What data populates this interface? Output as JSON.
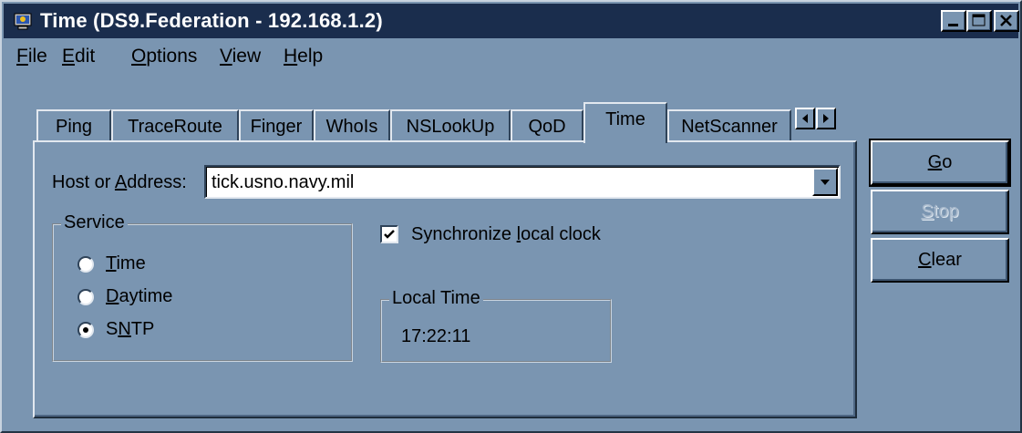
{
  "window": {
    "title": "Time (DS9.Federation - 192.168.1.2)"
  },
  "menubar": {
    "items": [
      {
        "label": "File",
        "mnemonic": "F",
        "rest": "ile"
      },
      {
        "label": "Edit",
        "mnemonic": "E",
        "rest": "dit"
      },
      {
        "label": "Options",
        "mnemonic": "O",
        "rest": "ptions"
      },
      {
        "label": "View",
        "mnemonic": "V",
        "rest": "iew"
      },
      {
        "label": "Help",
        "mnemonic": "H",
        "rest": "elp"
      }
    ]
  },
  "tabs": [
    {
      "label": "Ping"
    },
    {
      "label": "TraceRoute"
    },
    {
      "label": "Finger"
    },
    {
      "label": "WhoIs"
    },
    {
      "label": "NSLookUp"
    },
    {
      "label": "QoD"
    },
    {
      "label": "Time",
      "active": true
    },
    {
      "label": "NetScanner"
    }
  ],
  "host": {
    "label_pre": "Host or ",
    "label_mnemonic": "A",
    "label_post": "ddress:",
    "value": "tick.usno.navy.mil"
  },
  "service": {
    "legend": "Service",
    "options": [
      {
        "mnemonic": "T",
        "rest": "ime",
        "label": "Time",
        "selected": false
      },
      {
        "mnemonic": "D",
        "rest": "aytime",
        "label": "Daytime",
        "selected": false
      },
      {
        "pre": "S",
        "mnemonic": "N",
        "rest": "TP",
        "label": "SNTP",
        "selected": true
      }
    ]
  },
  "sync": {
    "label_pre": "Synchronize ",
    "label_mnemonic": "l",
    "label_post": "ocal clock",
    "checked": true
  },
  "local_time": {
    "legend": "Local Time",
    "value": "17:22:11"
  },
  "buttons": {
    "go": {
      "mnemonic": "G",
      "rest": "o"
    },
    "stop": {
      "mnemonic": "S",
      "rest": "top"
    },
    "clear": {
      "mnemonic": "C",
      "rest": "lear"
    }
  },
  "colors": {
    "face": "#7a95b1",
    "titlebar": "#1a2d4d"
  }
}
